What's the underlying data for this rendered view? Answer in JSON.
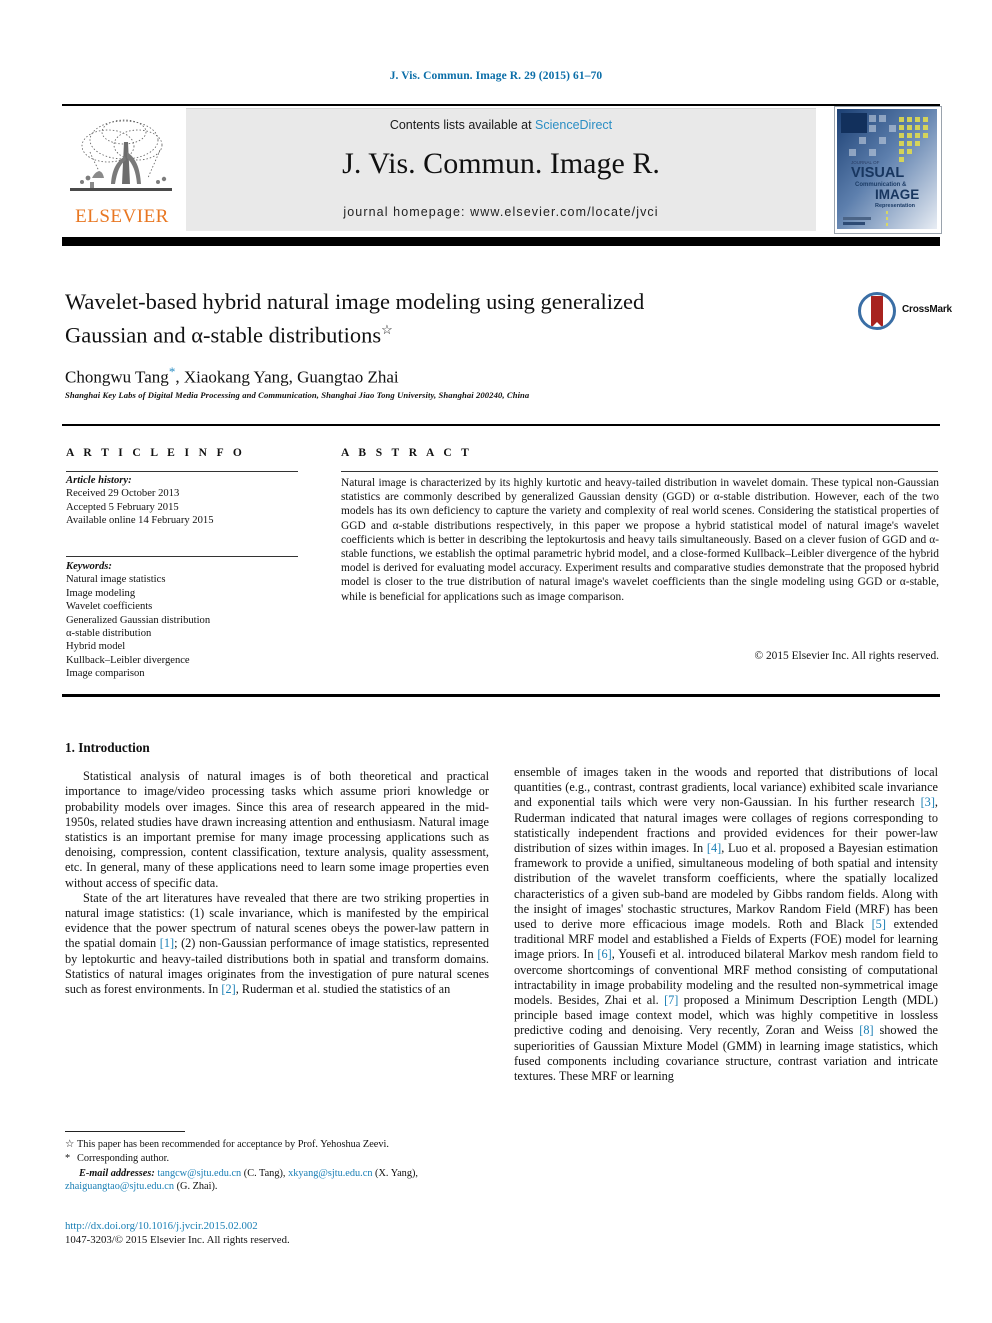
{
  "running_head": "J. Vis. Commun. Image R. 29 (2015) 61–70",
  "masthead": {
    "contents_prefix": "Contents lists available at ",
    "sciencedirect": "ScienceDirect",
    "journal_title": "J. Vis. Commun. Image R.",
    "homepage": "journal homepage: www.elsevier.com/locate/jvci",
    "publisher_wordmark": "ELSEVIER",
    "cover_lines": {
      "kicker": "JOURNAL OF",
      "l1": "VISUAL",
      "l2": "Communication &",
      "l3": "IMAGE",
      "l4": "Representation"
    }
  },
  "article": {
    "title_line1": "Wavelet-based hybrid natural image modeling using generalized",
    "title_line2": "Gaussian and α-stable distributions",
    "title_mark": "☆",
    "authors_a": "Chongwu Tang",
    "authors_star": "*",
    "authors_b": ", Xiaokang Yang, Guangtao Zhai",
    "affiliation": "Shanghai Key Labs of Digital Media Processing and Communication, Shanghai Jiao Tong University, Shanghai 200240, China",
    "crossmark_label": "CrossMark"
  },
  "info": {
    "heading": "A R T I C L E  I N F O",
    "history_label": "Article history:",
    "history": [
      "Received 29 October 2013",
      "Accepted 5 February 2015",
      "Available online 14 February 2015"
    ],
    "keywords_label": "Keywords:",
    "keywords": [
      "Natural image statistics",
      "Image modeling",
      "Wavelet coefficients",
      "Generalized Gaussian distribution",
      "α-stable distribution",
      "Hybrid model",
      "Kullback–Leibler divergence",
      "Image comparison"
    ]
  },
  "abstract": {
    "heading": "A B S T R A C T",
    "body": "Natural image is characterized by its highly kurtotic and heavy-tailed distribution in wavelet domain. These typical non-Gaussian statistics are commonly described by generalized Gaussian density (GGD) or α-stable distribution. However, each of the two models has its own deficiency to capture the variety and complexity of real world scenes. Considering the statistical properties of GGD and α-stable distributions respectively, in this paper we propose a hybrid statistical model of natural image's wavelet coefficients which is better in describing the leptokurtosis and heavy tails simultaneously. Based on a clever fusion of GGD and α-stable functions, we establish the optimal parametric hybrid model, and a close-formed Kullback–Leibler divergence of the hybrid model is derived for evaluating model accuracy. Experiment results and comparative studies demonstrate that the proposed hybrid model is closer to the true distribution of natural image's wavelet coefficients than the single modeling using GGD or α-stable, while is beneficial for applications such as image comparison.",
    "copyright": "© 2015 Elsevier Inc. All rights reserved."
  },
  "body": {
    "section_heading": "1. Introduction",
    "left_p1": "Statistical analysis of natural images is of both theoretical and practical importance to image/video processing tasks which assume priori knowledge or probability models over images. Since this area of research appeared in the mid-1950s, related studies have drawn increasing attention and enthusiasm. Natural image statistics is an important premise for many image processing applications such as denoising, compression, content classification, texture analysis, quality assessment, etc. In general, many of these applications need to learn some image properties even without access of specific data.",
    "left_p2_a": "State of the art literatures have revealed that there are two striking properties in natural image statistics: (1) scale invariance, which is manifested by the empirical evidence that the power spectrum of natural scenes obeys the power-law pattern in the spatial domain ",
    "left_ref_1": "[1]",
    "left_p2_b": "; (2) non-Gaussian performance of image statistics, represented by leptokurtic and heavy-tailed distributions both in spatial and transform domains. Statistics of natural images originates from the investigation of pure natural scenes such as forest environments. In ",
    "left_ref_2": "[2]",
    "left_p2_c": ", Ruderman et al. studied the statistics of an",
    "right_a": "ensemble of images taken in the woods and reported that distributions of local quantities (e.g., contrast, contrast gradients, local variance) exhibited scale invariance and exponential tails which were very non-Gaussian. In his further research ",
    "right_ref_3": "[3]",
    "right_b": ", Ruderman indicated that natural images were collages of regions corresponding to statistically independent fractions and provided evidences for their power-law distribution of sizes within images. In ",
    "right_ref_4": "[4]",
    "right_c": ", Luo et al. proposed a Bayesian estimation framework to provide a unified, simultaneous modeling of both spatial and intensity distribution of the wavelet transform coefficients, where the spatially localized characteristics of a given sub-band are modeled by Gibbs random fields. Along with the insight of images' stochastic structures, Markov Random Field (MRF) has been used to derive more efficacious image models. Roth and Black ",
    "right_ref_5": "[5]",
    "right_d": " extended traditional MRF model and established a Fields of Experts (FOE) model for learning image priors. In ",
    "right_ref_6": "[6]",
    "right_e": ", Yousefi et al. introduced bilateral Markov mesh random field to overcome shortcomings of conventional MRF method consisting of computational intractability in image probability modeling and the resulted non-symmetrical image models. Besides, Zhai et al. ",
    "right_ref_7": "[7]",
    "right_f": " proposed a Minimum Description Length (MDL) principle based image context model, which was highly competitive in lossless predictive coding and denoising. Very recently, Zoran and Weiss ",
    "right_ref_8": "[8]",
    "right_g": " showed the superiorities of Gaussian Mixture Model (GMM) in learning image statistics, which fused components including covariance structure, contrast variation and intricate textures. These MRF or learning"
  },
  "footnotes": {
    "fn1_mark": "☆",
    "fn1": "This paper has been recommended for acceptance by Prof. Yehoshua Zeevi.",
    "fn2_mark": "*",
    "fn2": "Corresponding author.",
    "email_label": "E-mail addresses:",
    "email1": "tangcw@sjtu.edu.cn",
    "email1_who": " (C. Tang), ",
    "email2": "xkyang@sjtu.edu.cn",
    "email2_who": " (X. Yang), ",
    "email3": "zhaiguangtao@sjtu.edu.cn",
    "email3_who": " (G. Zhai)."
  },
  "doi": {
    "url": "http://dx.doi.org/10.1016/j.jvcir.2015.02.002",
    "issn_line": "1047-3203/© 2015 Elsevier Inc. All rights reserved."
  },
  "colors": {
    "link": "#1a7fb5",
    "sciencedirect": "#2b8ec4",
    "elsevier_orange": "#e87722",
    "band": "#e9e9e9"
  }
}
